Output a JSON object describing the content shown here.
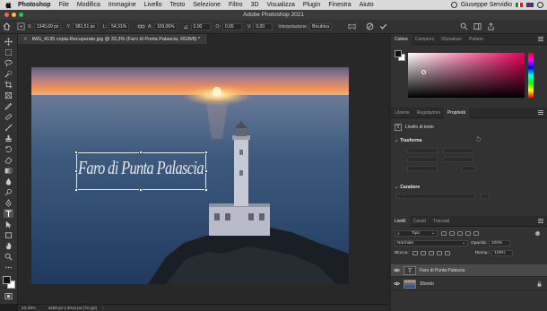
{
  "menubar": {
    "app_name": "Photoshop",
    "items": [
      "File",
      "Modifica",
      "Immagine",
      "Livello",
      "Testo",
      "Selezione",
      "Filtro",
      "3D",
      "Visualizza",
      "Plugin",
      "Finestra",
      "Aiuto"
    ],
    "user": "Giuseppe Servidio"
  },
  "window": {
    "title": "Adobe Photoshop 2021"
  },
  "options": {
    "x_label": "X:",
    "x_value": "1345,69 px",
    "y_label": "Y:",
    "y_value": "981,51 px",
    "w_label": "L:",
    "w_value": "54,31%",
    "h_label": "A:",
    "h_value": "109,06%",
    "angle_value": "0,00",
    "h_skew_label": "O:",
    "h_skew_value": "0,00",
    "v_skew_label": "V:",
    "v_skew_value": "0,00",
    "interp_label": "Interpolazione:",
    "interp_value": "Bicubica"
  },
  "document": {
    "tab_title": "IMG_4135 copia-Recuperato.jpg @ 33,3% (Faro di Punta Palascia, RGB/8) *",
    "canvas_text": "Faro di Punta Palascia"
  },
  "status": {
    "zoom": "33,33%",
    "doc_info": "4450 px x 3012 px (72 ppi)"
  },
  "color_panel": {
    "tabs": [
      "Colore",
      "Campioni",
      "Sfumature",
      "Pattern"
    ],
    "active": "Colore",
    "hue_color": "#e8005a"
  },
  "props_panel": {
    "tabs": [
      "Librerie",
      "Regolazioni",
      "Proprietà"
    ],
    "active": "Proprietà",
    "subtitle": "Livello di testo",
    "section_transform": "Trasforma",
    "section_char": "Carattere"
  },
  "layers_panel": {
    "tabs": [
      "Livelli",
      "Canali",
      "Tracciati"
    ],
    "active": "Livelli",
    "kind_filter": "Tipo",
    "blend_mode": "Normale",
    "opacity_label": "Opacità:",
    "opacity_value": "100%",
    "lock_label": "Blocca:",
    "fill_label": "Riemp.:",
    "fill_value": "100%",
    "layers": [
      {
        "name": "Faro di Punta Palascia",
        "type": "text",
        "selected": true
      },
      {
        "name": "Sfondo",
        "type": "image",
        "selected": false
      }
    ]
  }
}
